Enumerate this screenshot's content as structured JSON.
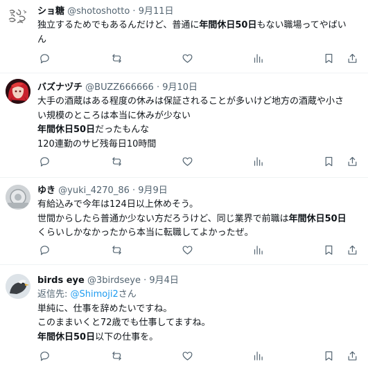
{
  "posts": [
    {
      "display_name": "ショ糖",
      "handle": "@shotoshotto",
      "date": "9月11日",
      "avatar": "sketch-doodle-avatar",
      "lines": [
        [
          {
            "t": "独立するためでもあるんだけど、普通に"
          },
          {
            "t": "年間休日50日",
            "b": true
          },
          {
            "t": "もない職場ってやばい"
          }
        ],
        [
          {
            "t": "ん"
          }
        ]
      ]
    },
    {
      "display_name": "バズナヅチ",
      "handle": "@BUZZ666666",
      "date": "9月10日",
      "avatar": "red-haired-character-avatar",
      "lines": [
        [
          {
            "t": "大手の酒蔵はある程度の休みは保証されることが多いけど地方の酒蔵や小さ"
          }
        ],
        [
          {
            "t": "い規模のところは本当に休みが少ない"
          }
        ],
        [
          {
            "t": "年間休日50日",
            "b": true
          },
          {
            "t": "だったもんな"
          }
        ],
        [
          {
            "t": "120連勤のサビ残毎日10時間"
          }
        ]
      ]
    },
    {
      "display_name": "ゆき",
      "handle": "@yuki_4270_86",
      "date": "9月9日",
      "avatar": "gray-photo-avatar",
      "lines": [
        [
          {
            "t": "有給込みで今年は124日以上休めそう。"
          }
        ],
        [
          {
            "t": "世間からしたら普通か少ない方だろうけど、同じ業界で前職は"
          },
          {
            "t": "年間休日50日",
            "b": true
          }
        ],
        [
          {
            "t": "くらいしかなかったから本当に転職してよかったぜ。"
          }
        ]
      ]
    },
    {
      "display_name": "birds eye",
      "handle": "@3birdseye",
      "date": "9月4日",
      "avatar": "bird-photo-avatar",
      "reply_prefix": "返信先: ",
      "reply_handle": "@Shimoji2",
      "reply_suffix": "さん",
      "lines": [
        [
          {
            "t": "単純に、仕事を辞めたいですね。"
          }
        ],
        [
          {
            "t": "このままいくと72歳でも仕事してますね。"
          }
        ],
        [
          {
            "t": "年間休日50日",
            "b": true
          },
          {
            "t": "以下の仕事を。"
          }
        ]
      ]
    }
  ],
  "colors": {
    "text": "#0f1419",
    "meta": "#536471",
    "link": "#1d9bf0",
    "divider": "#eff3f4"
  },
  "separator": " · "
}
